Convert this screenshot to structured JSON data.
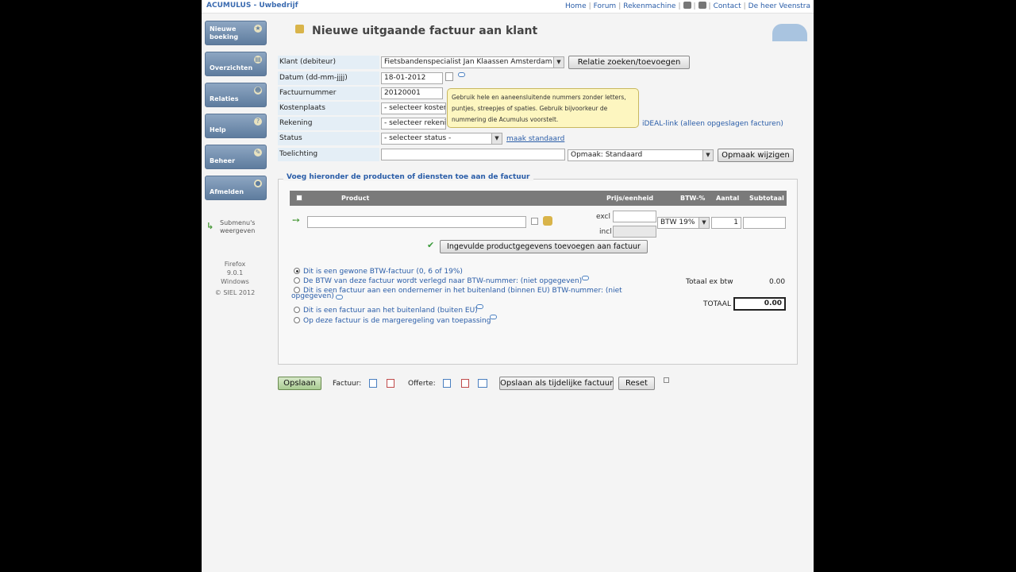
{
  "brand": "ACUMULUS - Uwbedrijf",
  "topnav": [
    "Home",
    "Forum",
    "Rekenmachine",
    "Contact",
    "De heer Veenstra"
  ],
  "sidebar": [
    {
      "label": "Nieuwe boeking",
      "icon": "star-icon"
    },
    {
      "label": "Overzichten",
      "icon": "pages-icon"
    },
    {
      "label": "Relaties",
      "icon": "people-icon"
    },
    {
      "label": "Help",
      "icon": "help-icon"
    },
    {
      "label": "Beheer",
      "icon": "tools-icon"
    },
    {
      "label": "Afmelden",
      "icon": "power-icon"
    }
  ],
  "submenu": "Submenu's weergeven",
  "sysinfo": {
    "browser": "Firefox",
    "version": "9.0.1",
    "os": "Windows",
    "copyright": "© SIEL 2012"
  },
  "title": "Nieuwe uitgaande factuur aan klant",
  "form": {
    "klant_label": "Klant (debiteur)",
    "klant_value": "Fietsbandenspecialist Jan Klaassen Amsterdam",
    "relatie_button": "Relatie zoeken/toevoegen",
    "datum_label": "Datum (dd-mm-jjjj)",
    "datum_value": "18-01-2012",
    "factuurnummer_label": "Factuurnummer",
    "factuurnummer_value": "20120001",
    "kostenplaats_label": "Kostenplaats",
    "kostenplaats_value": "- selecteer kosten",
    "rekening_label": "Rekening",
    "rekening_value": "- selecteer rekenin",
    "ideal_link": "iDEAL-link (alleen opgeslagen facturen)",
    "status_label": "Status",
    "status_value": "- selecteer status -",
    "maak_standaard": "maak standaard",
    "toelichting_label": "Toelichting",
    "opmaak_value": "Opmaak: Standaard",
    "opmaak_button": "Opmaak wijzigen"
  },
  "tooltip": "Gebruik hele en aaneensluitende nummers zonder letters, puntjes, streepjes of spaties. Gebruik bijvoorkeur de nummering die Acumulus voorstelt.",
  "products": {
    "legend": "Voeg hieronder de producten of diensten toe aan de factuur",
    "headers": {
      "product": "Product",
      "prijs": "Prijs/eenheid",
      "btw": "BTW-%",
      "aantal": "Aantal",
      "subtotaal": "Subtotaal"
    },
    "excl": "excl",
    "incl": "incl",
    "btw_value": "BTW 19%",
    "aantal_value": "1",
    "add_button": "Ingevulde productgegevens toevoegen aan factuur"
  },
  "options": [
    "Dit is een gewone BTW-factuur (0, 6 of 19%)",
    "De BTW van deze factuur wordt verlegd naar BTW-nummer: (niet opgegeven)",
    "Dit is een factuur aan een ondernemer in het buitenland (binnen EU) BTW-nummer: (niet",
    "opgegeven)",
    "Dit is een factuur aan het buitenland (buiten EU)",
    "Op deze factuur is de margeregeling van toepassing"
  ],
  "totals": {
    "excl_label": "Totaal ex btw",
    "excl_value": "0.00",
    "total_label": "TOTAAL",
    "total_value": "0.00"
  },
  "footer": {
    "save": "Opslaan",
    "factuur": "Factuur:",
    "offerte": "Offerte:",
    "save_temp": "Opslaan als tijdelijke factuur",
    "reset": "Reset"
  }
}
